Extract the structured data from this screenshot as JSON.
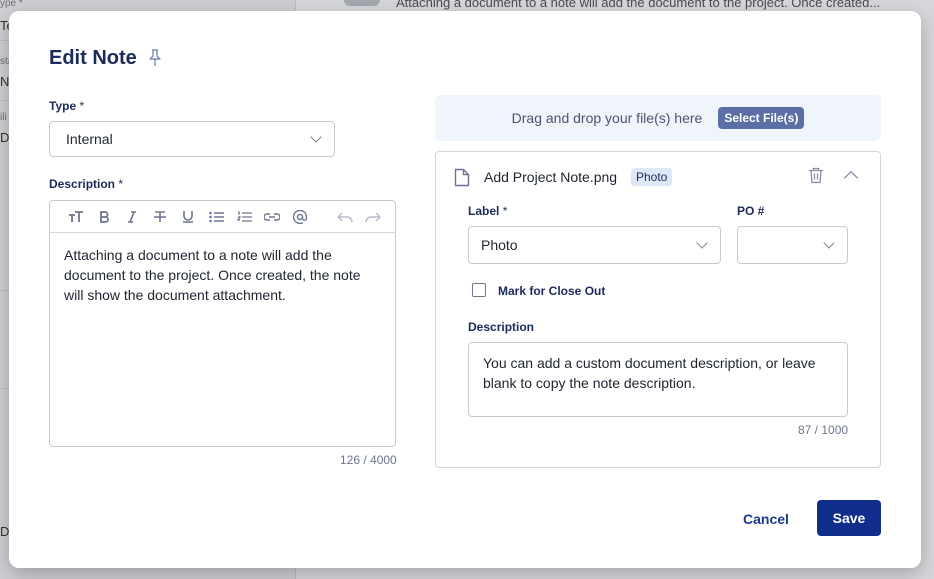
{
  "background": {
    "left_fragments": [
      "ype *",
      "Te",
      "sta",
      "N",
      "ili",
      "Da",
      "Da"
    ],
    "top_text": "Attaching a document to a note will add the document to the project. Once created..."
  },
  "modal": {
    "title": "Edit Note",
    "pin_icon": "pin-icon"
  },
  "type_field": {
    "label": "Type",
    "required_mark": "*",
    "value": "Internal"
  },
  "description_field": {
    "label": "Description",
    "required_mark": "*",
    "toolbar": [
      "text-size-icon",
      "bold-icon",
      "italic-icon",
      "strikethrough-icon",
      "underline-icon",
      "bullet-list-icon",
      "numbered-list-icon",
      "link-icon",
      "mention-icon",
      "undo-icon",
      "redo-icon"
    ],
    "text": "Attaching a document to a note will add the document to the project. Once created, the note will show the document attachment.",
    "counter": "126 / 4000"
  },
  "dropzone": {
    "text": "Drag and drop your file(s) here",
    "button": "Select File(s)"
  },
  "file": {
    "name": "Add Project Note.png",
    "badge": "Photo",
    "label_field": {
      "label": "Label",
      "required_mark": "*",
      "value": "Photo"
    },
    "po_field": {
      "label": "PO #",
      "value": ""
    },
    "close_out": {
      "label": "Mark for Close Out",
      "checked": false
    },
    "description": {
      "label": "Description",
      "text": "You can add a custom document description, or leave blank to copy the note description.",
      "counter": "87 / 1000"
    }
  },
  "actions": {
    "cancel": "Cancel",
    "save": "Save"
  },
  "colors": {
    "primary": "#0f2e8c",
    "heading": "#1c2a5c",
    "badge_bg": "#dfe8f7",
    "dropzone_bg": "#f0f4fb"
  }
}
